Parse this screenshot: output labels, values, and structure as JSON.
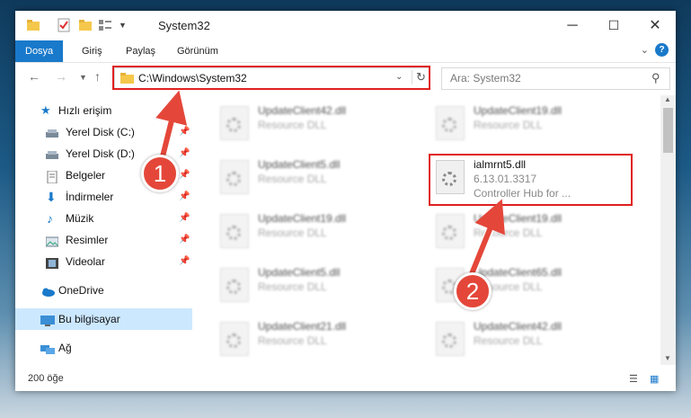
{
  "window": {
    "title": "System32"
  },
  "ribbon": {
    "tabs": [
      "Dosya",
      "Giriş",
      "Paylaş",
      "Görünüm"
    ]
  },
  "address": {
    "path": "C:\\Windows\\System32"
  },
  "search": {
    "placeholder": "Ara: System32"
  },
  "sidebar": {
    "items": [
      {
        "label": "Hızlı erişim",
        "icon": "star-icon"
      },
      {
        "label": "Yerel Disk (C:)",
        "icon": "drive-icon"
      },
      {
        "label": "Yerel Disk (D:)",
        "icon": "drive-icon"
      },
      {
        "label": "Belgeler",
        "icon": "document-icon"
      },
      {
        "label": "İndirmeler",
        "icon": "download-icon"
      },
      {
        "label": "Müzik",
        "icon": "music-icon"
      },
      {
        "label": "Resimler",
        "icon": "pictures-icon"
      },
      {
        "label": "Videolar",
        "icon": "video-icon"
      },
      {
        "label": "OneDrive",
        "icon": "cloud-icon"
      },
      {
        "label": "Bu bilgisayar",
        "icon": "computer-icon"
      },
      {
        "label": "Ağ",
        "icon": "network-icon"
      }
    ]
  },
  "files": [
    {
      "name": "UpdateClient42.dll",
      "line2": "Resource DLL",
      "line3": ""
    },
    {
      "name": "UpdateClient19.dll",
      "line2": "Resource DLL",
      "line3": ""
    },
    {
      "name": "UpdateClient5.dll",
      "line2": "Resource DLL",
      "line3": ""
    },
    {
      "name": "ialmrnt5.dll",
      "line2": "6.13.01.3317",
      "line3": "Controller Hub for ..."
    },
    {
      "name": "UpdateClient19.dll",
      "line2": "Resource DLL",
      "line3": ""
    },
    {
      "name": "UpdateClient19.dll",
      "line2": "Resource DLL",
      "line3": ""
    },
    {
      "name": "UpdateClient5.dll",
      "line2": "Resource DLL",
      "line3": ""
    },
    {
      "name": "UpdateClient65.dll",
      "line2": "Resource DLL",
      "line3": ""
    },
    {
      "name": "UpdateClient21.dll",
      "line2": "Resource DLL",
      "line3": ""
    },
    {
      "name": "UpdateClient42.dll",
      "line2": "Resource DLL",
      "line3": ""
    }
  ],
  "status": {
    "count": "200 öğe"
  },
  "annotations": {
    "step1": "1",
    "step2": "2"
  },
  "colors": {
    "accent": "#1979ca",
    "highlight": "#e02020",
    "badge": "#e4473a",
    "selected": "#cce8ff"
  }
}
